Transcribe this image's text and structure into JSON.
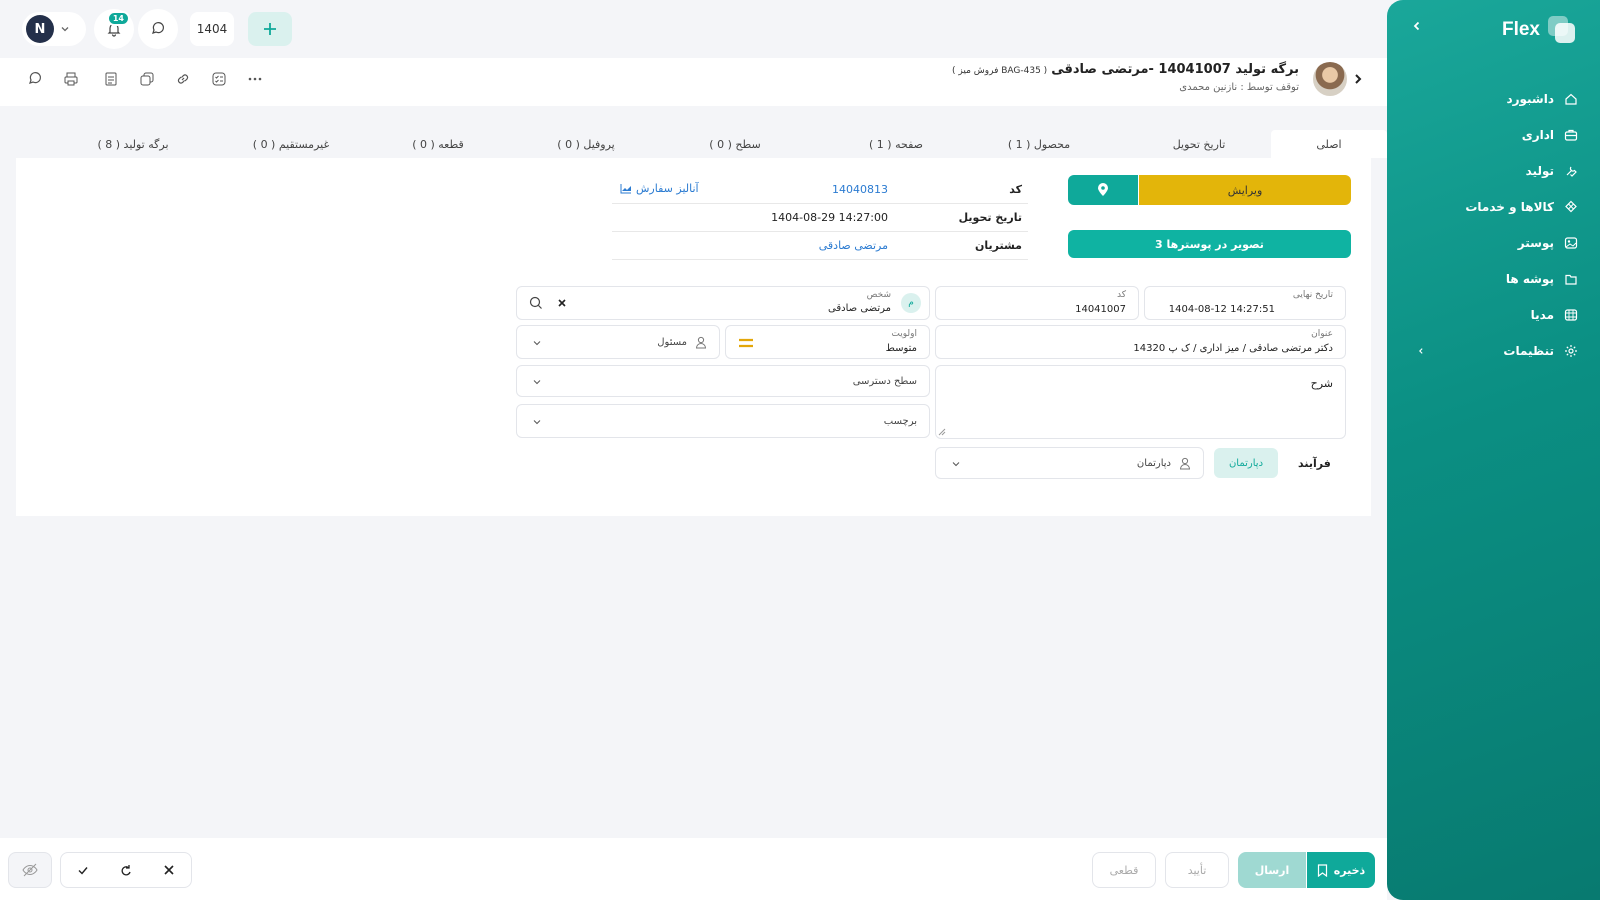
{
  "topbar": {
    "year": "1404",
    "notif_count": "14",
    "add_icon": "plus-icon",
    "avatar_initials": "N"
  },
  "header": {
    "title": "برگه تولید 14041007 -مرتضی صادقی",
    "subtitle_tag": "( فروش میز BAG-435 )",
    "stopped_by": "توقف توسط : نازنین محمدی"
  },
  "toolbar": {
    "icons": [
      "chat-icon",
      "print-icon",
      "notes-icon",
      "duplicate-icon",
      "link-icon",
      "checklist-icon",
      "more-icon"
    ]
  },
  "tabs": [
    {
      "label": "اصلی",
      "active": true
    },
    {
      "label": "تاریخ تحویل"
    },
    {
      "label": "محصول ( 1 )"
    },
    {
      "label": "صفحه ( 1 )"
    },
    {
      "label": "سطح ( 0 )"
    },
    {
      "label": "پروفیل ( 0 )"
    },
    {
      "label": "قطعه ( 0 )"
    },
    {
      "label": "غیرمستقیم ( 0 )"
    },
    {
      "label": "برگه تولید ( 8 )"
    }
  ],
  "actions": {
    "edit_label": "ویرایش",
    "posters_label": "3 تصویر در پوسترها"
  },
  "info": {
    "code_label": "کد",
    "code_value": "14040813",
    "order_analysis": "آنالیز سفارش",
    "delivery_label": "تاریخ تحویل",
    "delivery_value": "1404-08-29 14:27:00",
    "customers_label": "مشتریان",
    "customers_value": "مرتضی صادقی"
  },
  "form": {
    "final_date_label": "تاریخ نهایی",
    "final_date_value": "1404-08-12 14:27:51",
    "code_label": "کد",
    "code_value": "14041007",
    "person_label": "شخص",
    "person_value": "مرتضی صادقی",
    "person_avatar": "م",
    "title_label": "عنوان",
    "title_value": "دکتر مرتضی صادقی / میز اداری / ک پ 14320",
    "priority_label": "اولویت",
    "priority_value": "متوسط",
    "responsible_placeholder": "مسئول",
    "description_label": "شرح",
    "access_label": "سطح دسترسی",
    "tag_label": "برچسب",
    "process_label": "فرآیند",
    "department_chip": "دپارتمان",
    "department_placeholder": "دپارتمان"
  },
  "sidebar": {
    "brand": "Flex",
    "items": [
      {
        "label": "داشبورد",
        "icon": "home-icon"
      },
      {
        "label": "اداری",
        "icon": "briefcase-icon"
      },
      {
        "label": "تولید",
        "icon": "tools-icon"
      },
      {
        "label": "کالاها و خدمات",
        "icon": "cube-icon"
      },
      {
        "label": "پوستر",
        "icon": "poster-icon"
      },
      {
        "label": "پوشه ها",
        "icon": "folder-icon"
      },
      {
        "label": "مدیا",
        "icon": "media-icon"
      },
      {
        "label": "تنظیمات",
        "icon": "settings-icon"
      }
    ]
  },
  "footer": {
    "save_label": "ذخیره",
    "send_label": "ارسال",
    "confirm_label": "تأیید",
    "final_label": "قطعی"
  },
  "colors": {
    "teal": "#0fa99a",
    "gold": "#e3b50a",
    "link": "#2b7bd1"
  }
}
